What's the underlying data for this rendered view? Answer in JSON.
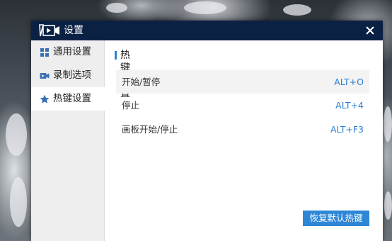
{
  "window": {
    "title": "设置",
    "icon": "video-camera-icon",
    "close_icon": "close-icon"
  },
  "sidebar": {
    "items": [
      {
        "label": "通用设置",
        "icon": "grid-icon",
        "active": false
      },
      {
        "label": "录制选项",
        "icon": "video-icon",
        "active": false
      },
      {
        "label": "热键设置",
        "icon": "star-icon",
        "active": true
      }
    ]
  },
  "main": {
    "section_title": "热键设置",
    "hotkeys": [
      {
        "name": "开始/暂停",
        "key": "ALT+O",
        "highlighted": true
      },
      {
        "name": "停止",
        "key": "ALT+4",
        "highlighted": false
      },
      {
        "name": "画板开始/停止",
        "key": "ALT+F3",
        "highlighted": false
      }
    ],
    "restore_button": "恢复默认热键"
  },
  "colors": {
    "titlebar": "#0b2144",
    "accent": "#2b7fd4",
    "sidebar_bg": "#eeeeee"
  }
}
